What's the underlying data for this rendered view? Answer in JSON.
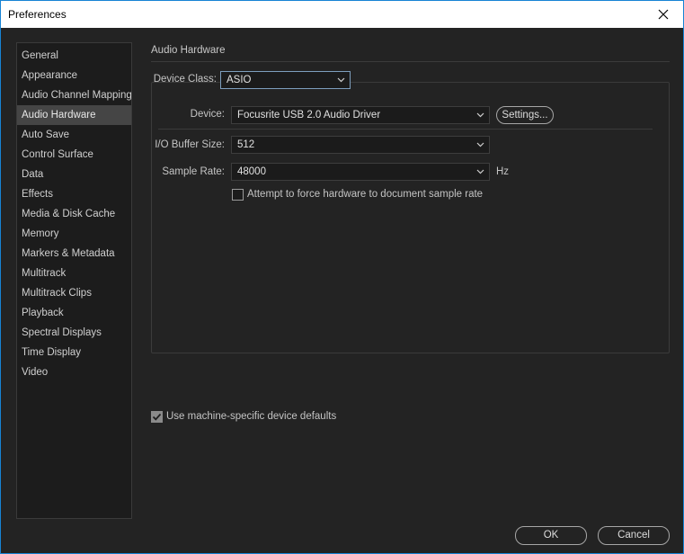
{
  "window": {
    "title": "Preferences"
  },
  "sidebar": {
    "items": [
      {
        "label": "General"
      },
      {
        "label": "Appearance"
      },
      {
        "label": "Audio Channel Mapping"
      },
      {
        "label": "Audio Hardware",
        "selected": true
      },
      {
        "label": "Auto Save"
      },
      {
        "label": "Control Surface"
      },
      {
        "label": "Data"
      },
      {
        "label": "Effects"
      },
      {
        "label": "Media & Disk Cache"
      },
      {
        "label": "Memory"
      },
      {
        "label": "Markers & Metadata"
      },
      {
        "label": "Multitrack"
      },
      {
        "label": "Multitrack Clips"
      },
      {
        "label": "Playback"
      },
      {
        "label": "Spectral Displays"
      },
      {
        "label": "Time Display"
      },
      {
        "label": "Video"
      }
    ]
  },
  "panel": {
    "title": "Audio Hardware",
    "device_class": {
      "label": "Device Class:",
      "value": "ASIO"
    },
    "device": {
      "label": "Device:",
      "value": "Focusrite USB 2.0 Audio Driver",
      "settings_label": "Settings..."
    },
    "buffer_size": {
      "label": "I/O Buffer Size:",
      "value": "512"
    },
    "sample_rate": {
      "label": "Sample Rate:",
      "value": "48000",
      "unit": "Hz"
    },
    "force_rate": {
      "label": "Attempt to force hardware to document sample rate",
      "checked": false
    },
    "machine_defaults": {
      "label": "Use machine-specific device defaults",
      "checked": true
    }
  },
  "footer": {
    "ok_label": "OK",
    "cancel_label": "Cancel"
  },
  "colors": {
    "background": "#232323",
    "sidebar_selected": "#454545",
    "titlebar": "#ffffff",
    "border_accent": "#1783d4"
  }
}
